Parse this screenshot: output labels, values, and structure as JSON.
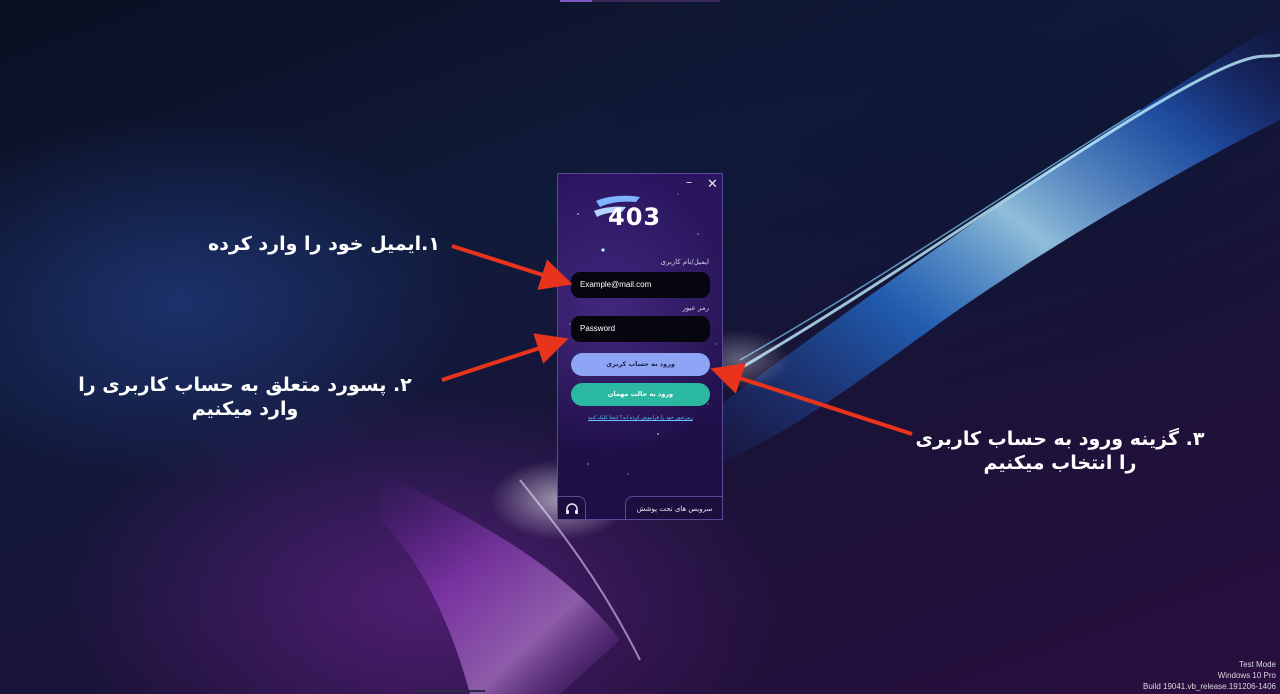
{
  "app": {
    "logo_text": "403",
    "window_controls": {
      "minimize": "–",
      "close": "✕"
    },
    "email_label": "ایمیل/نام کاربری",
    "email_placeholder": "Example@mail.com",
    "password_label": "رمز عبور",
    "password_placeholder": "Password",
    "login_button": "ورود به حساب کربری",
    "guest_button": "ورود به حالت مهمان",
    "forgot_link": "رمزعبور خود را فراموش کرده اید؟ اینجا کلیک کنید",
    "support_icon": "headset-icon",
    "services_button": "سرویس های تحت پوشش"
  },
  "annotations": {
    "step1": "۱.ایمیل خود را وارد کرده",
    "step2_line1": "۲. پسورد متعلق به حساب کاربری را",
    "step2_line2": "وارد میکنیم",
    "step3_line1": "۳. گزینه ورود به حساب کاربری",
    "step3_line2": "را انتخاب میکنیم"
  },
  "watermark": {
    "line1": "Test Mode",
    "line2": "Windows 10 Pro",
    "line3": "Build 19041.vb_release.191206-1406"
  },
  "colors": {
    "arrow": "#e8341c",
    "login_button": "#8ea4f4",
    "guest_button": "#2ab9a0",
    "window_bg": "#241250"
  }
}
